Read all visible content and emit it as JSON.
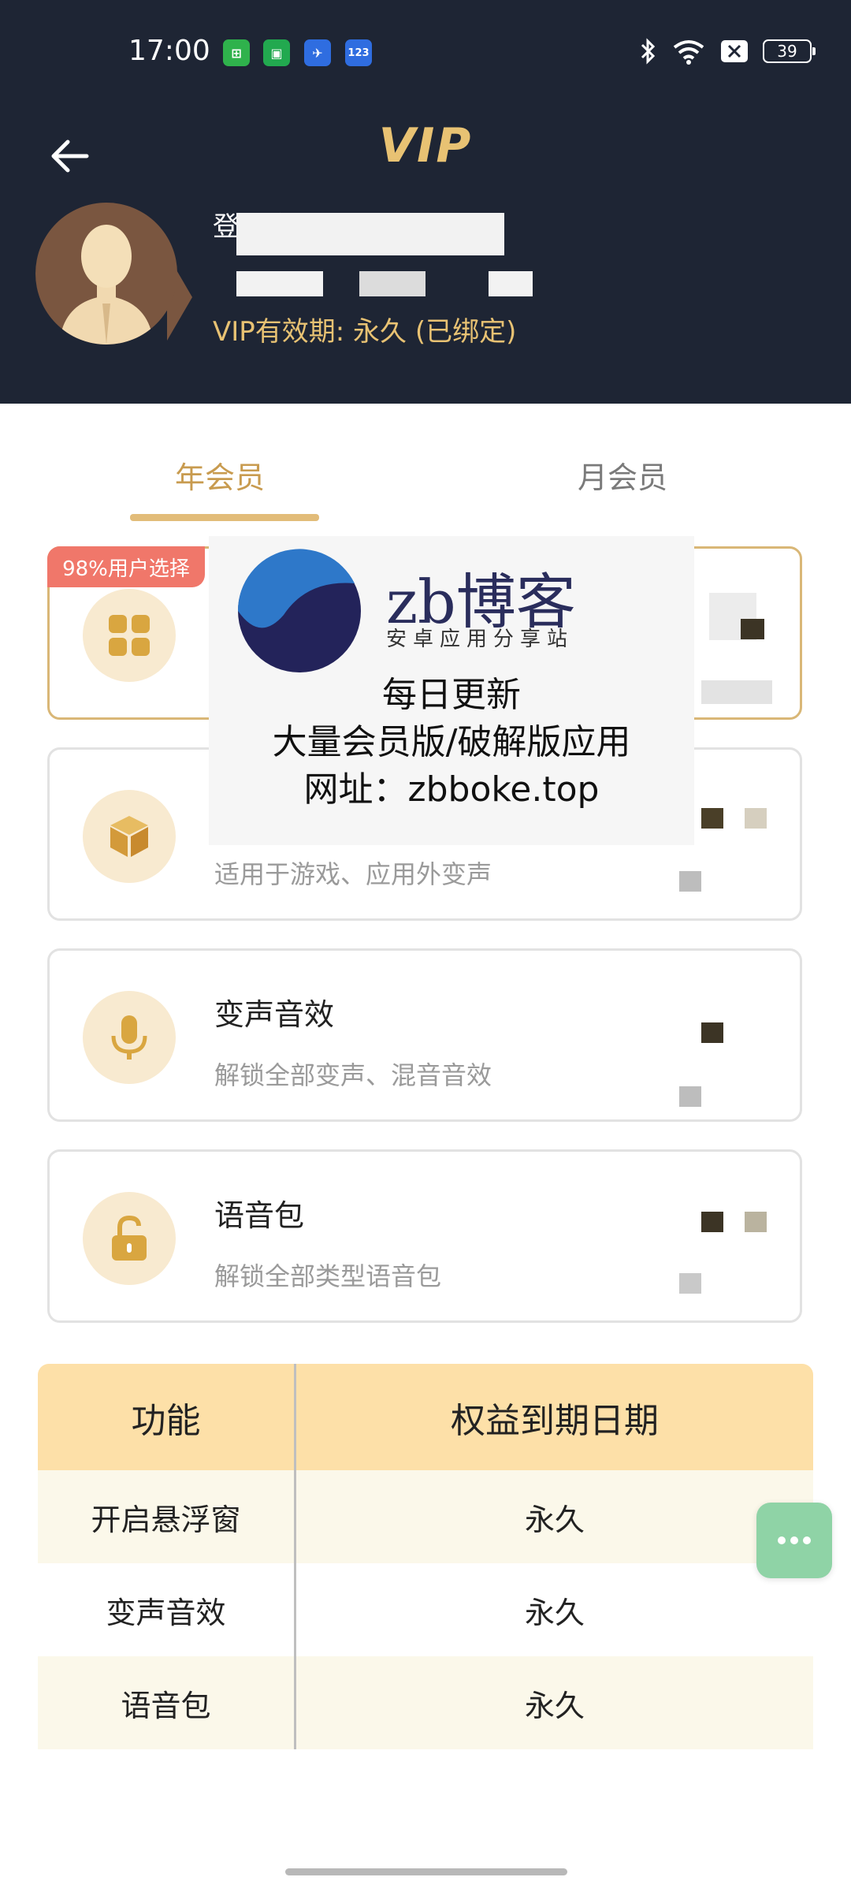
{
  "status_bar": {
    "time": "17:00",
    "app_icons": [
      {
        "name": "green-app-icon",
        "color": "#2fb24c",
        "glyph": "⊞"
      },
      {
        "name": "shield-app-icon",
        "color": "#22a94f",
        "glyph": "▣"
      },
      {
        "name": "bird-app-icon",
        "color": "#2f6de0",
        "glyph": "✈"
      },
      {
        "name": "123-app-icon",
        "color": "#2f6de0",
        "glyph": "123"
      }
    ],
    "battery": "39"
  },
  "header": {
    "title": "VIP",
    "login_method": "登录方式：手机号登录",
    "vip_validity": "VIP有效期:   永久  (已绑定)"
  },
  "tabs": [
    {
      "label": "年会员",
      "active": true
    },
    {
      "label": "月会员",
      "active": false
    }
  ],
  "popular_badge": "98%用户选择",
  "cards": [
    {
      "title": "",
      "desc": "",
      "icon": "apps-grid-icon"
    },
    {
      "title": "",
      "desc": "适用于游戏、应用外变声",
      "icon": "cube-box-icon"
    },
    {
      "title": "变声音效",
      "desc": "解锁全部变声、混音音效",
      "icon": "microphone-icon"
    },
    {
      "title": "语音包",
      "desc": "解锁全部类型语音包",
      "icon": "unlock-padlock-icon"
    }
  ],
  "watermark": {
    "brand": "zb博客",
    "subtitle": "安卓应用分享站",
    "line1": "每日更新",
    "line2": "大量会员版/破解版应用",
    "line3": "网址：zbboke.top"
  },
  "table": {
    "headers": [
      "功能",
      "权益到期日期"
    ],
    "rows": [
      [
        "开启悬浮窗",
        "永久"
      ],
      [
        "变声音效",
        "永久"
      ],
      [
        "语音包",
        "永久"
      ]
    ]
  },
  "colors": {
    "header_bg": "#1e2534",
    "gold": "#e8c273",
    "tab_active": "#c89b4f",
    "table_head": "#fde0a8",
    "badge": "#f0776a",
    "float_button": "#8fd3a6"
  }
}
